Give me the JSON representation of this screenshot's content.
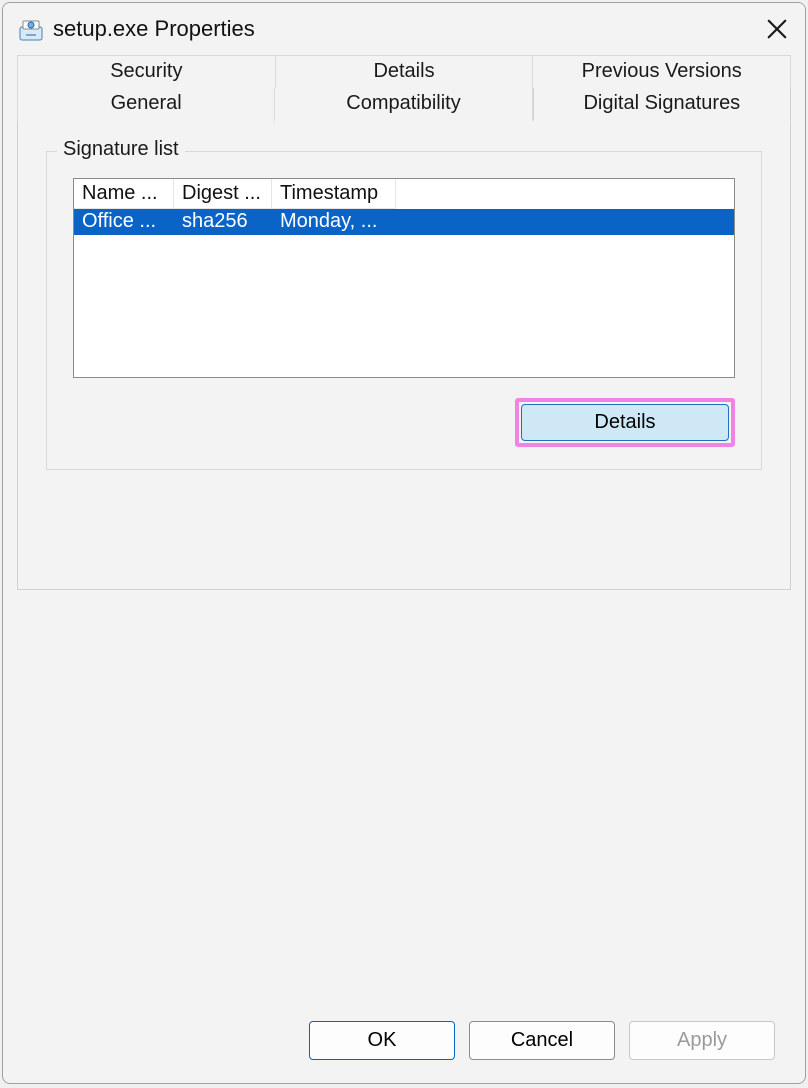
{
  "window": {
    "title": "setup.exe Properties"
  },
  "tabs": {
    "row1": [
      {
        "label": "Security"
      },
      {
        "label": "Details"
      },
      {
        "label": "Previous Versions"
      }
    ],
    "row2": [
      {
        "label": "General"
      },
      {
        "label": "Compatibility"
      },
      {
        "label": "Digital Signatures",
        "active": true
      }
    ]
  },
  "group": {
    "title": "Signature list"
  },
  "list": {
    "headers": {
      "name": "Name ...",
      "digest": "Digest ...",
      "timestamp": "Timestamp"
    },
    "rows": [
      {
        "name": "Office ...",
        "digest": "sha256",
        "timestamp": "Monday, ..."
      }
    ]
  },
  "buttons": {
    "details": "Details",
    "ok": "OK",
    "cancel": "Cancel",
    "apply": "Apply"
  },
  "icons": {
    "app": "installer-icon",
    "close": "close-icon"
  }
}
